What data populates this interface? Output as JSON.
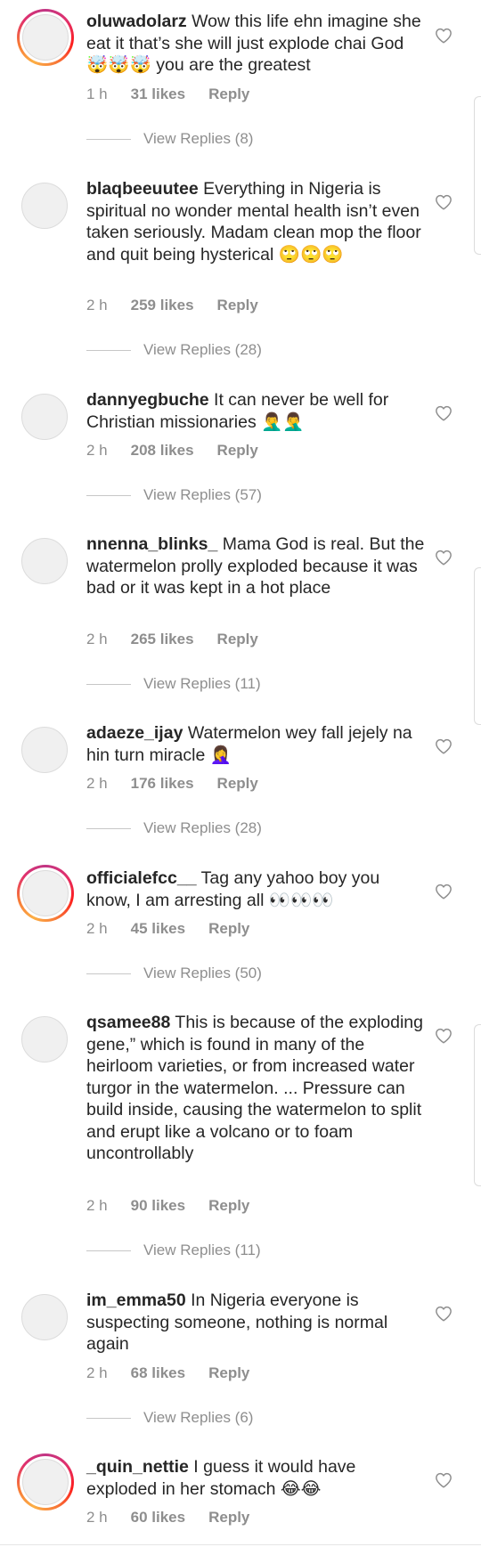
{
  "comments": [
    {
      "username": "oluwadolarz",
      "text": "Wow this life ehn imagine she eat it that’s she will just explode chai God 🤯🤯🤯 you are the greatest",
      "time": "1 h",
      "likes": "31 likes",
      "reply_label": "Reply",
      "view_replies": "View Replies (8)",
      "story_ring": true
    },
    {
      "username": "blaqbeeuutee",
      "text": "Everything in Nigeria is spiritual no wonder mental health isn’t even taken seriously. Madam clean mop the floor and quit being hysterical 🙄🙄🙄",
      "time": "2 h",
      "likes": "259 likes",
      "reply_label": "Reply",
      "view_replies": "View Replies (28)",
      "story_ring": false
    },
    {
      "username": "dannyegbuche",
      "text": "It can never  be well for Christian missionaries 🤦‍♂️🤦‍♂️",
      "time": "2 h",
      "likes": "208 likes",
      "reply_label": "Reply",
      "view_replies": "View Replies (57)",
      "story_ring": false
    },
    {
      "username": "nnenna_blinks_",
      "text": "Mama God is real. But the watermelon prolly exploded because it was bad or it was kept in a hot place",
      "time": "2 h",
      "likes": "265 likes",
      "reply_label": "Reply",
      "view_replies": "View Replies (11)",
      "story_ring": false
    },
    {
      "username": "adaeze_ijay",
      "text": "Watermelon wey fall jejely na hin turn miracle 🤦‍♀️",
      "time": "2 h",
      "likes": "176 likes",
      "reply_label": "Reply",
      "view_replies": "View Replies (28)",
      "story_ring": false
    },
    {
      "username": "officialefcc__",
      "text": "Tag any yahoo boy you know, I am arresting all 👀👀👀",
      "time": "2 h",
      "likes": "45 likes",
      "reply_label": "Reply",
      "view_replies": "View Replies (50)",
      "story_ring": true
    },
    {
      "username": "qsamee88",
      "text": "This is because of the exploding gene,” which is found in many of the heirloom varieties, or from increased water turgor in the watermelon. ... Pressure can build inside, causing the watermelon to split and erupt like a volcano or to foam uncontrollably",
      "time": "2 h",
      "likes": "90 likes",
      "reply_label": "Reply",
      "view_replies": "View Replies (11)",
      "story_ring": false
    },
    {
      "username": "im_emma50",
      "text": "In Nigeria everyone is suspecting someone,  nothing is normal again",
      "time": "2 h",
      "likes": "68 likes",
      "reply_label": "Reply",
      "view_replies": "View Replies (6)",
      "story_ring": false
    },
    {
      "username": "_quin_nettie",
      "text": "I guess it would have exploded in her stomach 😂😂",
      "time": "2 h",
      "likes": "60 likes",
      "reply_label": "Reply",
      "view_replies": "",
      "story_ring": true
    }
  ],
  "icons": {
    "like": "heart-outline-icon"
  },
  "colors": {
    "text": "#262626",
    "secondary": "#8e8e8e",
    "story_ring_start": "#c13584",
    "story_ring_end": "#fcaf45"
  }
}
